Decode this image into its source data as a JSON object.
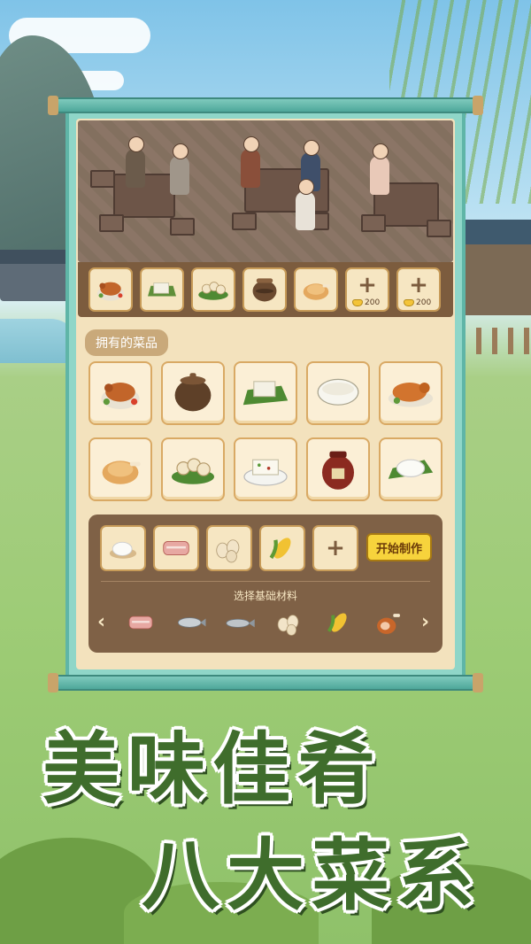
{
  "menu": {
    "dishes": [
      "roast-duck-icon",
      "tofu-icon",
      "dumplings-icon",
      "clay-pot-icon",
      "roast-chicken-icon"
    ],
    "unlock_slots": [
      {
        "plus": "+",
        "cost": "200"
      },
      {
        "plus": "+",
        "cost": "200"
      }
    ]
  },
  "owned": {
    "tab_label": "拥有的菜品",
    "dishes": [
      "roast-duck-icon",
      "stew-pot-icon",
      "tofu-leaf-icon",
      "porridge-bowl-icon",
      "roast-pig-icon",
      "roast-chicken-icon",
      "dumplings-icon",
      "tofu-plate-icon",
      "wine-jar-icon",
      "rice-ball-icon"
    ]
  },
  "craft": {
    "ingredients": [
      "flour-icon",
      "pork-icon",
      "eggs-icon",
      "corn-icon"
    ],
    "add_symbol": "+",
    "start_button": "开始制作",
    "select_label": "选择基础材料",
    "left_arrow": "‹",
    "right_arrow": "›",
    "materials": [
      "pork-icon",
      "fish-icon",
      "fish-2-icon",
      "eggs-icon",
      "corn-icon",
      "ham-icon"
    ]
  },
  "headline": {
    "line1": "美味佳肴",
    "line2": "八大菜系"
  },
  "colors": {
    "scroll_teal": "#8fd6c8",
    "paper": "#f3e2bd",
    "brown_panel": "#7f6146",
    "button_yellow": "#f7d33c",
    "title_green": "#3f6d2c"
  }
}
